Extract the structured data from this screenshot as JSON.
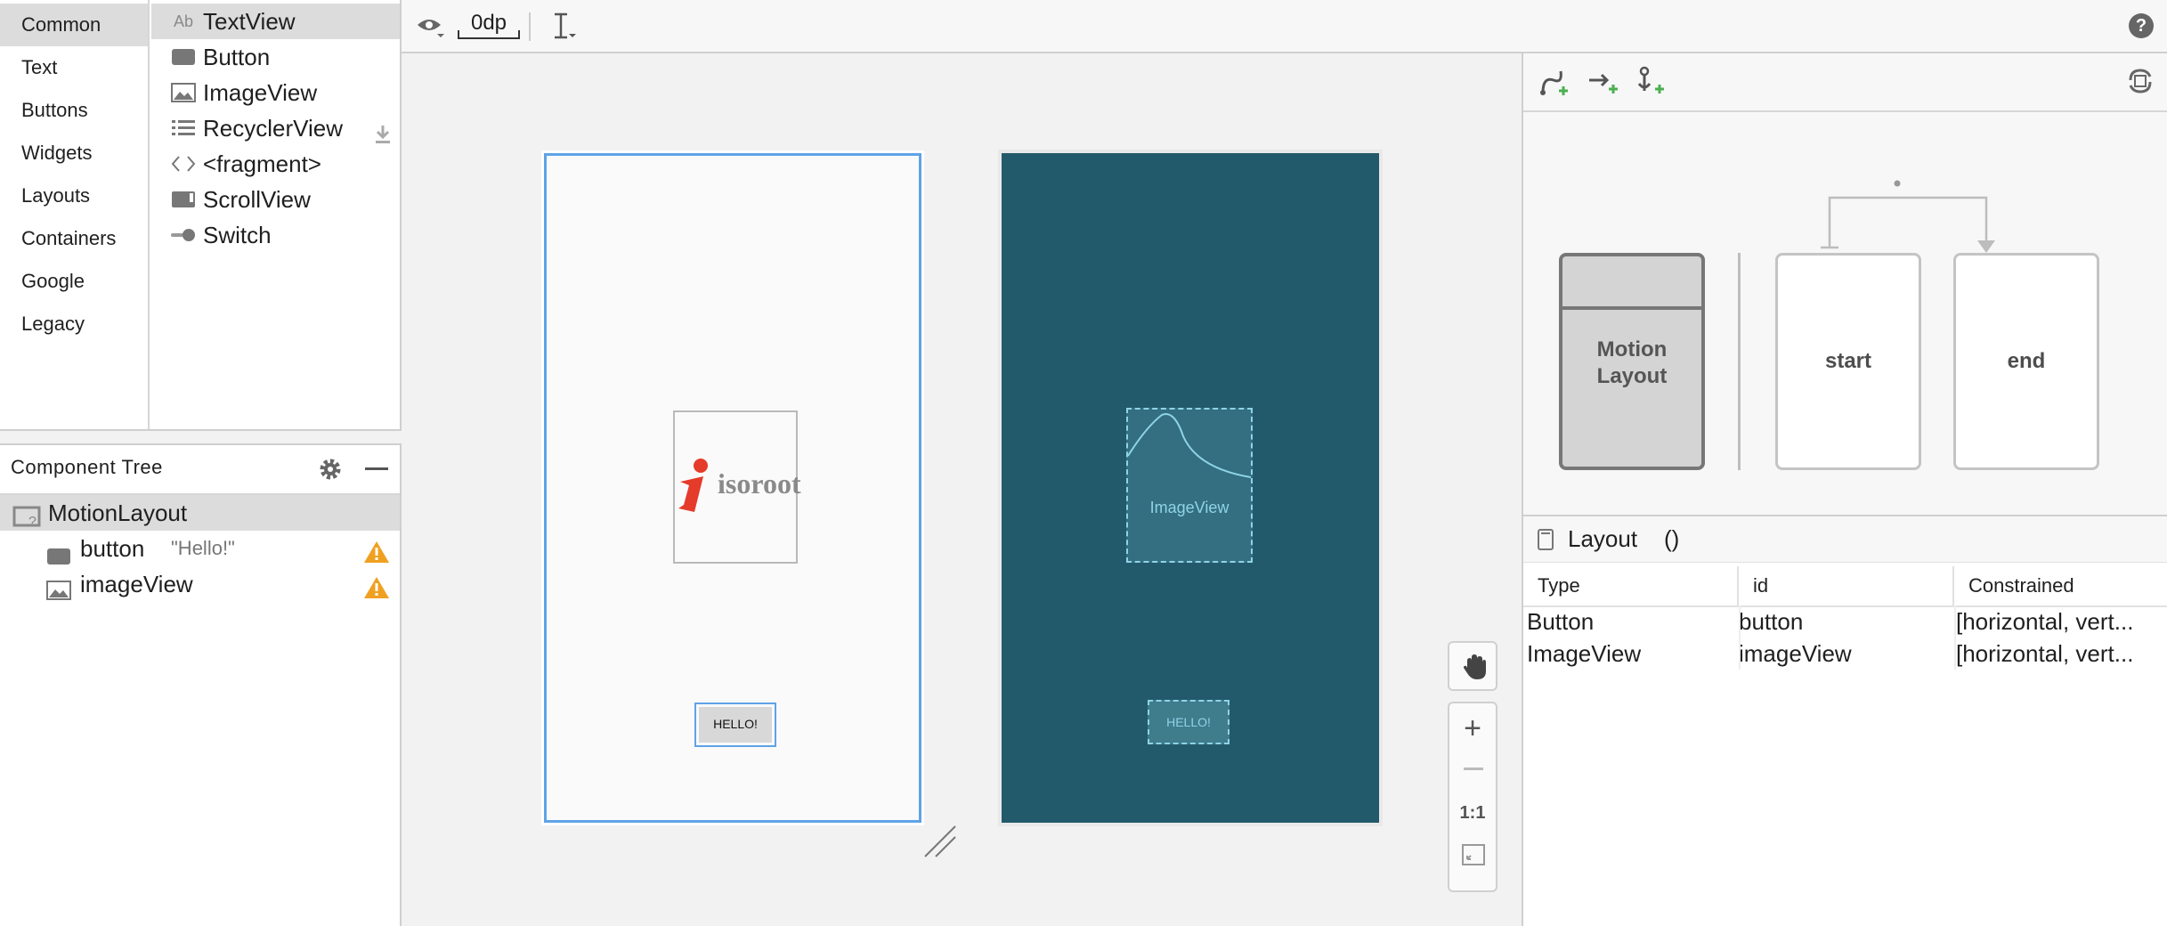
{
  "palette": {
    "categories": [
      "Common",
      "Text",
      "Buttons",
      "Widgets",
      "Layouts",
      "Containers",
      "Google",
      "Legacy"
    ],
    "widgets": [
      {
        "label": "TextView",
        "icon": "textview-icon",
        "glyph": "Ab"
      },
      {
        "label": "Button",
        "icon": "button-icon"
      },
      {
        "label": "ImageView",
        "icon": "imageview-icon"
      },
      {
        "label": "RecyclerView",
        "icon": "list-icon"
      },
      {
        "label": "<fragment>",
        "icon": "code-brackets-icon",
        "glyph": "<>"
      },
      {
        "label": "ScrollView",
        "icon": "scrollview-icon"
      },
      {
        "label": "Switch",
        "icon": "switch-icon"
      }
    ]
  },
  "component_tree": {
    "title": "Component Tree",
    "root": "MotionLayout",
    "children": [
      {
        "name": "button",
        "detail": "\"Hello!\""
      },
      {
        "name": "imageView",
        "detail": ""
      }
    ]
  },
  "toolbar": {
    "margin_value": "0dp"
  },
  "canvas": {
    "logo_text": "isoroot",
    "button_text": "HELLO!",
    "imageview_label": "ImageView",
    "zoom_one_to_one": "1:1"
  },
  "motion_editor": {
    "layout_card": "Motion Layout",
    "start_card": "start",
    "end_card": "end"
  },
  "attributes": {
    "title": "Layout",
    "title_suffix": "()",
    "columns": [
      "Type",
      "id",
      "Constrained"
    ],
    "rows": [
      {
        "type": "Button",
        "id": "button",
        "constrained": "[horizontal, vert..."
      },
      {
        "type": "ImageView",
        "id": "imageView",
        "constrained": "[horizontal, vert..."
      }
    ]
  },
  "colors": {
    "selection_gray": "#dcdcdc",
    "blueprint_teal": "#235a6b",
    "design_blue": "#5fa3e8",
    "warning": "#f0a020",
    "add_green": "#4caf50"
  }
}
